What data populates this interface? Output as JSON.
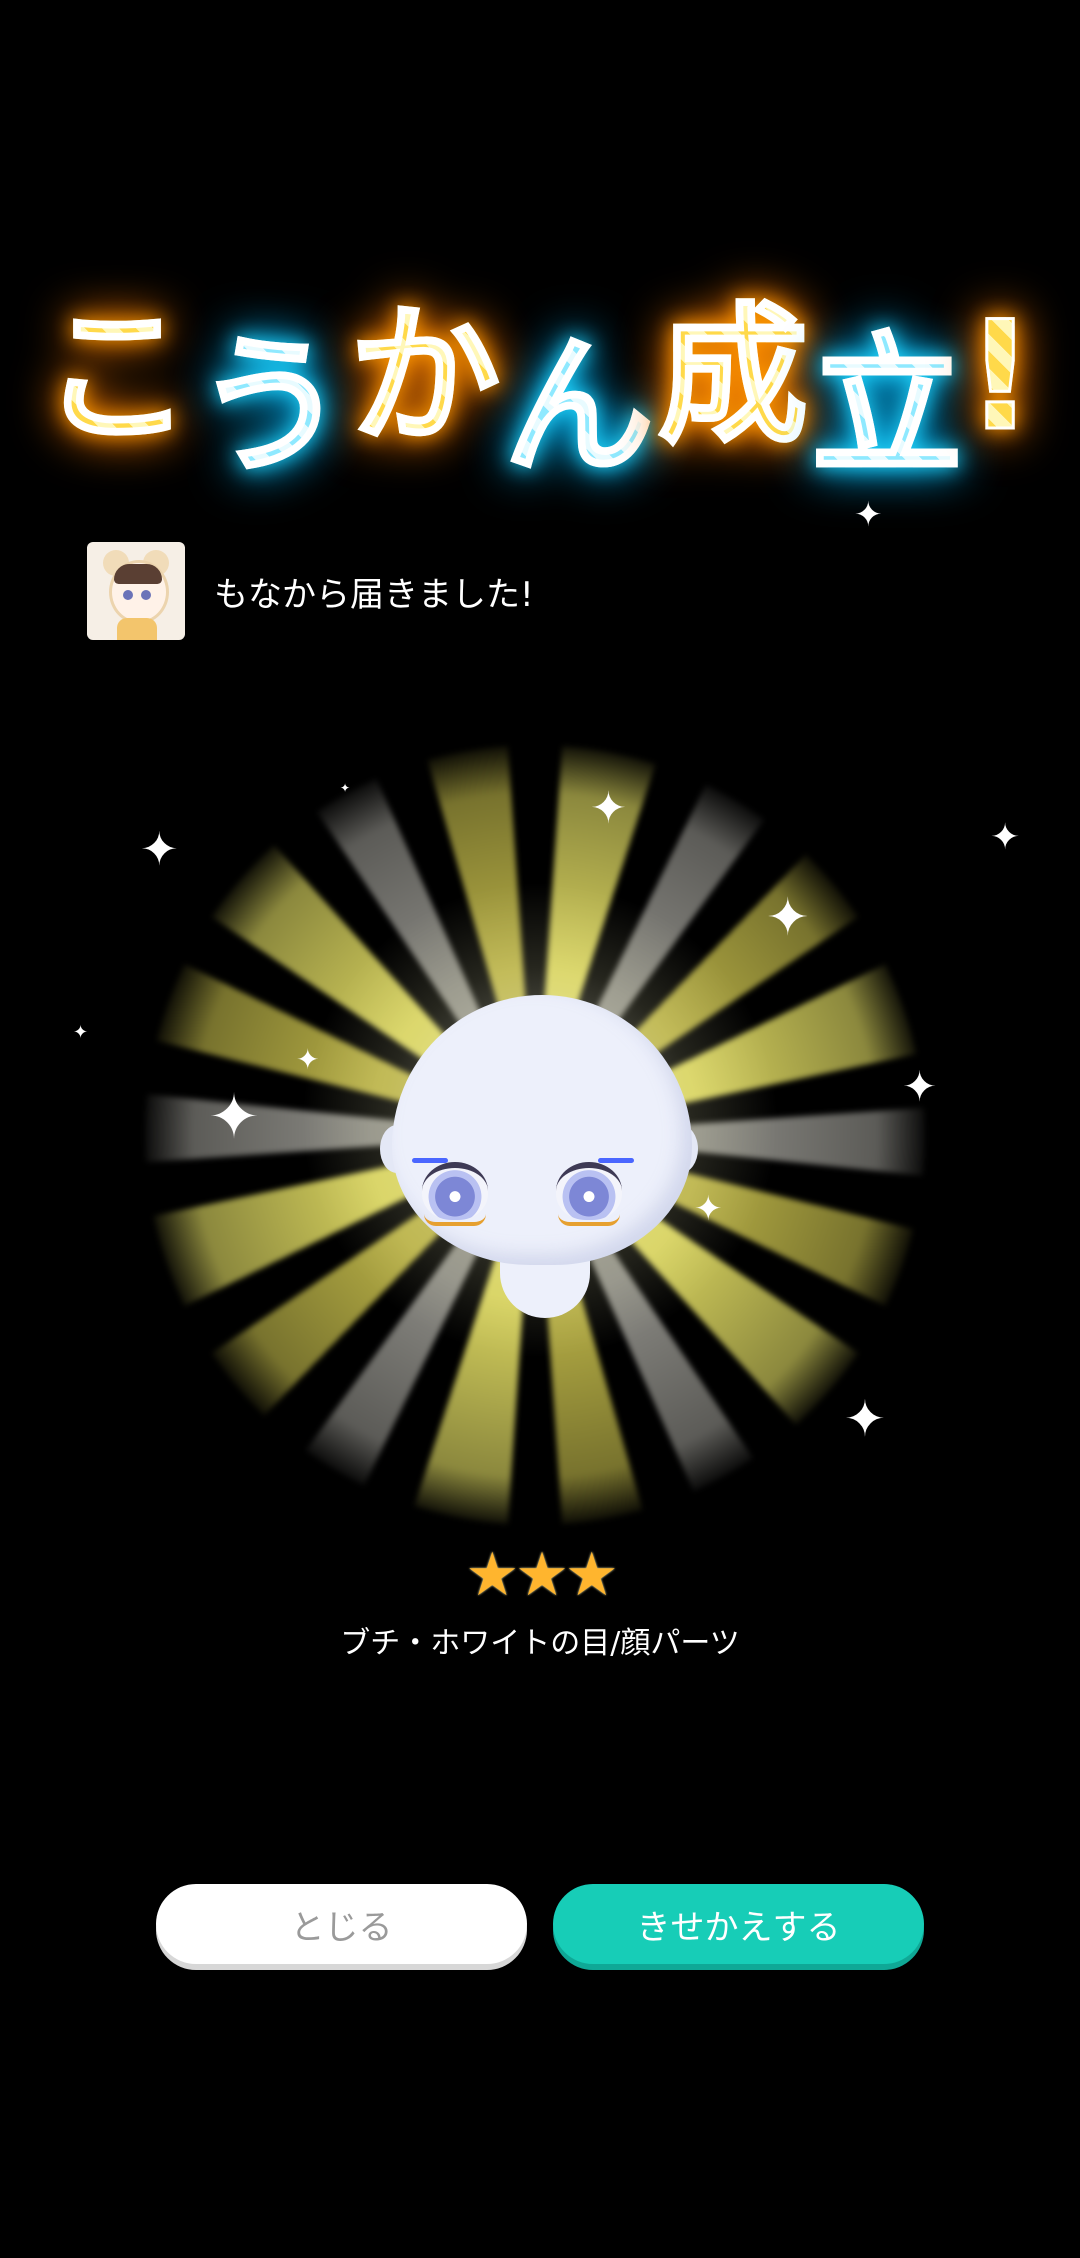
{
  "title": {
    "chars": [
      "こ",
      "う",
      "か",
      "ん",
      "成",
      "立",
      "!"
    ]
  },
  "sender": {
    "message": "もなから届きました!"
  },
  "item": {
    "rarity_stars": 3,
    "stars_text": "★★★",
    "name": "ブチ・ホワイトの目/顔パーツ"
  },
  "buttons": {
    "close_label": "とじる",
    "dress_label": "きせかえする"
  },
  "colors": {
    "background": "#000000",
    "primary_button": "#17CDB7",
    "secondary_button": "#FFFFFF",
    "star": "#FFB52E"
  }
}
